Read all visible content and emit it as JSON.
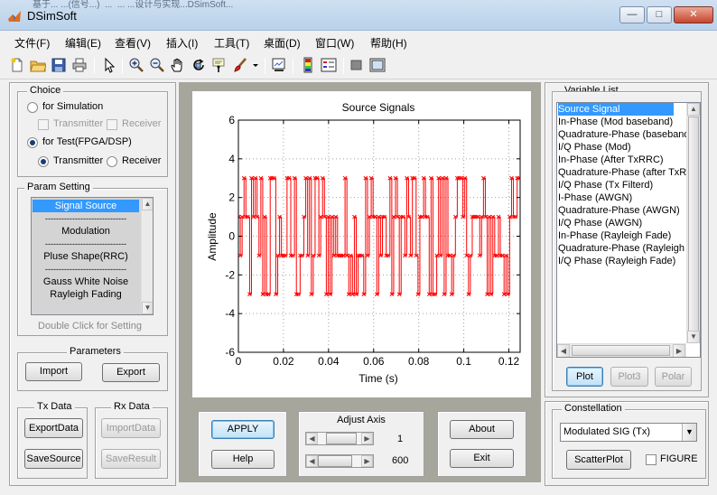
{
  "window": {
    "behind_title": "基于... ...(信号...)  ...  ... ...设计与实现...DSimSoft...",
    "title": "DSimSoft",
    "minimize": "—",
    "maximize": "□",
    "close": "✕"
  },
  "menu": [
    "文件(F)",
    "编辑(E)",
    "查看(V)",
    "插入(I)",
    "工具(T)",
    "桌面(D)",
    "窗口(W)",
    "帮助(H)"
  ],
  "toolbar_icons": [
    "new-file-icon",
    "open-folder-icon",
    "save-icon",
    "print-icon",
    "pointer-icon",
    "zoom-in-icon",
    "zoom-out-icon",
    "pan-hand-icon",
    "rotate-3d-icon",
    "data-cursor-icon",
    "brush-icon",
    "dropdown-arrow-icon",
    "link-plot-icon",
    "colorbar-icon",
    "legend-icon",
    "hide-plot-tools-icon",
    "show-plot-tools-icon"
  ],
  "choice": {
    "title": "Choice",
    "for_simulation": "for Simulation",
    "sim_transmitter": "Transmitter",
    "sim_receiver": "Receiver",
    "for_test": "for Test(FPGA/DSP)",
    "test_transmitter": "Transmitter",
    "test_receiver": "Receiver",
    "selected_mode": "for Test(FPGA/DSP)",
    "selected_side": "Transmitter"
  },
  "param_setting": {
    "title": "Param Setting",
    "items": [
      "Signal Source",
      "------------------------------",
      "Modulation",
      "------------------------------",
      "Pluse Shape(RRC)",
      "------------------------------",
      "Gauss White Noise",
      "Rayleigh Fading"
    ],
    "selected": "Signal Source",
    "hint": "Double Click for Setting"
  },
  "parameters": {
    "title": "Parameters",
    "import": "Import",
    "export": "Export"
  },
  "tx_data": {
    "title": "Tx Data",
    "export": "ExportData",
    "save": "SaveSource"
  },
  "rx_data": {
    "title": "Rx Data",
    "import": "ImportData",
    "save": "SaveResult"
  },
  "chart_data": {
    "type": "line",
    "title": "Source Signals",
    "xlabel": "Time (s)",
    "ylabel": "Amplitude",
    "xlim": [
      0,
      0.125
    ],
    "ylim": [
      -6,
      6
    ],
    "xticks": [
      "0",
      "0.02",
      "0.04",
      "0.06",
      "0.08",
      "0.1",
      "0.12"
    ],
    "yticks": [
      "6",
      "4",
      "2",
      "0",
      "-2",
      "-4",
      "-6"
    ],
    "levels": [
      -3,
      -1,
      1,
      3
    ],
    "symbol_period": 0.00083,
    "grid": true,
    "series": [
      {
        "color": "#ff0000",
        "marker": "x"
      }
    ]
  },
  "controls": {
    "apply": "APPLY",
    "help": "Help",
    "adjust_axis_title": "Adjust Axis",
    "axis_value_1": "1",
    "axis_value_2": "600",
    "about": "About",
    "exit": "Exit"
  },
  "variable_list": {
    "title": "Variable List",
    "items": [
      "Source Signal",
      "In-Phase (Mod baseband)",
      "Quadrature-Phase (baseband",
      "I/Q Phase (Mod)",
      "In-Phase (After TxRRC)",
      "Quadrature-Phase (after TxR",
      "I/Q Phase (Tx Filterd)",
      "I-Phase (AWGN)",
      "Quadrature-Phase (AWGN)",
      "I/Q Phase (AWGN)",
      "In-Phase (Rayleigh Fade)",
      "Quadrature-Phase (Rayleigh F",
      "I/Q Phase (Rayleigh Fade)"
    ],
    "selected": "Source Signal",
    "plot": "Plot",
    "plot3": "Plot3",
    "polar": "Polar"
  },
  "constellation": {
    "title": "Constellation",
    "selected": "Modulated SIG (Tx)",
    "scatter": "ScatterPlot",
    "figure": "FIGURE"
  }
}
